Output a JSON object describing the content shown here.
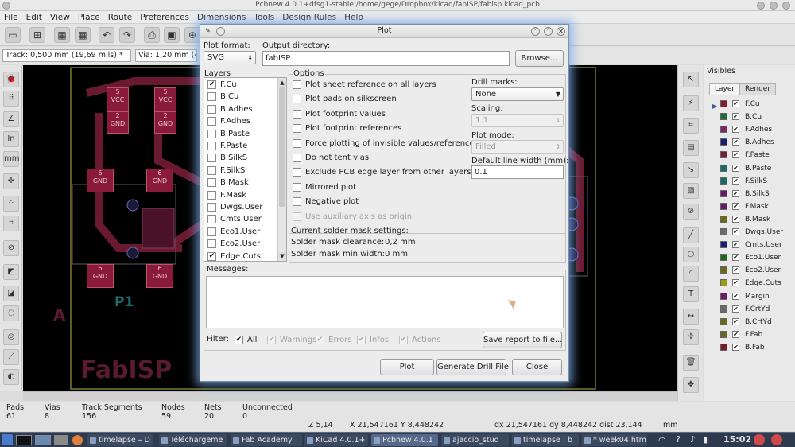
{
  "window": {
    "title": "Pcbnew 4.0.1+dfsg1-stable /home/gege/Dropbox/kicad/fabISP/fabisp.kicad_pcb"
  },
  "menu": [
    "File",
    "Edit",
    "View",
    "Place",
    "Route",
    "Preferences",
    "Dimensions",
    "Tools",
    "Design Rules",
    "Help"
  ],
  "optbar": {
    "track": "Track: 0,500 mm (19,69 mils) *",
    "via": "Via: 1,20 mm (4"
  },
  "pcb": {
    "pads": [
      {
        "num": "6",
        "net": "GND"
      },
      {
        "num": "6",
        "net": "GND"
      },
      {
        "num": "6",
        "net": "GND"
      },
      {
        "num": "6",
        "net": "GND"
      }
    ],
    "small_pads": [
      {
        "num": "5",
        "net": "VCC"
      },
      {
        "num": "5",
        "net": "VCC"
      },
      {
        "num": "2",
        "net": "GND"
      },
      {
        "num": "2",
        "net": "GND"
      }
    ],
    "label_p1": "P1",
    "label_a": "A",
    "label_fabisp": "FabISP"
  },
  "visibles": {
    "title": "Visibles",
    "tabs": [
      "Layer",
      "Render"
    ],
    "layers": [
      {
        "name": "F.Cu",
        "color": "#8b1a2e",
        "checked": true
      },
      {
        "name": "B.Cu",
        "color": "#1e6e3c",
        "checked": true
      },
      {
        "name": "F.Adhes",
        "color": "#7a2a6a",
        "checked": true
      },
      {
        "name": "B.Adhes",
        "color": "#1a1a7a",
        "checked": true
      },
      {
        "name": "F.Paste",
        "color": "#7a1a3a",
        "checked": true
      },
      {
        "name": "B.Paste",
        "color": "#1a6a6a",
        "checked": true
      },
      {
        "name": "F.SilkS",
        "color": "#1a6a6a",
        "checked": true
      },
      {
        "name": "B.SilkS",
        "color": "#6a1a6a",
        "checked": true
      },
      {
        "name": "F.Mask",
        "color": "#6a1a6a",
        "checked": true
      },
      {
        "name": "B.Mask",
        "color": "#6a6a1a",
        "checked": true
      },
      {
        "name": "Dwgs.User",
        "color": "#6a6a6a",
        "checked": true
      },
      {
        "name": "Cmts.User",
        "color": "#1a1a7a",
        "checked": true
      },
      {
        "name": "Eco1.User",
        "color": "#1a6a1a",
        "checked": true
      },
      {
        "name": "Eco2.User",
        "color": "#6a6a1a",
        "checked": true
      },
      {
        "name": "Edge.Cuts",
        "color": "#9a9a1a",
        "checked": true
      },
      {
        "name": "Margin",
        "color": "#6a1a6a",
        "checked": true
      },
      {
        "name": "F.CrtYd",
        "color": "#6a6a6a",
        "checked": true
      },
      {
        "name": "B.CrtYd",
        "color": "#6a6a1a",
        "checked": true
      },
      {
        "name": "F.Fab",
        "color": "#6a6a1a",
        "checked": true
      },
      {
        "name": "B.Fab",
        "color": "#7a1a2a",
        "checked": true
      }
    ]
  },
  "status": {
    "headers": [
      "Pads",
      "Vias",
      "Track Segments",
      "Nodes",
      "Nets",
      "Unconnected"
    ],
    "values": [
      "61",
      "8",
      "156",
      "59",
      "20",
      "0"
    ]
  },
  "coords": {
    "z": "Z 5,14",
    "xy": "X 21,547161  Y 8,448242",
    "dxy": "dx 21,547161  dy 8,448242  dist 23,144",
    "unit": "mm"
  },
  "taskbar": {
    "tasks": [
      "timelapse – D",
      "Téléchargeme",
      "Fab Academy",
      "KiCad 4.0.1+",
      "Pcbnew 4.0.1",
      "ajaccio_stud",
      "timelapse : b",
      "* week04.htm"
    ],
    "clock": "15:02"
  },
  "dialog": {
    "title": "Plot",
    "plot_format_label": "Plot format:",
    "plot_format_value": "SVG",
    "output_dir_label": "Output directory:",
    "output_dir_value": "fabISP",
    "browse_label": "Browse...",
    "layers_label": "Layers",
    "layers": [
      {
        "name": "F.Cu",
        "checked": true
      },
      {
        "name": "B.Cu",
        "checked": false
      },
      {
        "name": "B.Adhes",
        "checked": false
      },
      {
        "name": "F.Adhes",
        "checked": false
      },
      {
        "name": "B.Paste",
        "checked": false
      },
      {
        "name": "F.Paste",
        "checked": false
      },
      {
        "name": "B.SilkS",
        "checked": false
      },
      {
        "name": "F.SilkS",
        "checked": false
      },
      {
        "name": "B.Mask",
        "checked": false
      },
      {
        "name": "F.Mask",
        "checked": false
      },
      {
        "name": "Dwgs.User",
        "checked": false
      },
      {
        "name": "Cmts.User",
        "checked": false
      },
      {
        "name": "Eco1.User",
        "checked": false
      },
      {
        "name": "Eco2.User",
        "checked": false
      },
      {
        "name": "Edge.Cuts",
        "checked": true
      }
    ],
    "options_label": "Options",
    "options": [
      {
        "label": "Plot sheet reference on all layers",
        "checked": false,
        "disabled": false
      },
      {
        "label": "Plot pads on silkscreen",
        "checked": false,
        "disabled": false
      },
      {
        "label": "Plot footprint values",
        "checked": false,
        "disabled": false
      },
      {
        "label": "Plot footprint references",
        "checked": false,
        "disabled": false
      },
      {
        "label": "Force plotting of invisible values/references",
        "checked": false,
        "disabled": false
      },
      {
        "label": "Do not tent vias",
        "checked": false,
        "disabled": false
      },
      {
        "label": "Exclude PCB edge layer from other layers",
        "checked": false,
        "disabled": false
      },
      {
        "label": "Mirrored plot",
        "checked": false,
        "disabled": false
      },
      {
        "label": "Negative plot",
        "checked": false,
        "disabled": false
      },
      {
        "label": "Use auxiliary axis as origin",
        "checked": false,
        "disabled": true
      }
    ],
    "drill_marks_label": "Drill marks:",
    "drill_marks_value": "None",
    "scaling_label": "Scaling:",
    "scaling_value": "1:1",
    "plot_mode_label": "Plot mode:",
    "plot_mode_value": "Filled",
    "line_width_label": "Default line width (mm):",
    "line_width_value": "0.1",
    "solder_mask_title": "Current solder mask settings:",
    "solder_clearance_label": "Solder mask clearance:",
    "solder_clearance_value": "0,2 mm",
    "solder_minwidth_label": "Solder mask min width:",
    "solder_minwidth_value": "0 mm",
    "messages_label": "Messages:",
    "filter_label": "Filter:",
    "filters": [
      {
        "label": "All",
        "checked": true,
        "disabled": false
      },
      {
        "label": "Warnings",
        "checked": true,
        "disabled": true
      },
      {
        "label": "Errors",
        "checked": true,
        "disabled": true
      },
      {
        "label": "Infos",
        "checked": true,
        "disabled": true
      },
      {
        "label": "Actions",
        "checked": true,
        "disabled": true
      }
    ],
    "save_report_label": "Save report to file...",
    "plot_button": "Plot",
    "generate_drill_button": "Generate Drill File",
    "close_button": "Close"
  }
}
